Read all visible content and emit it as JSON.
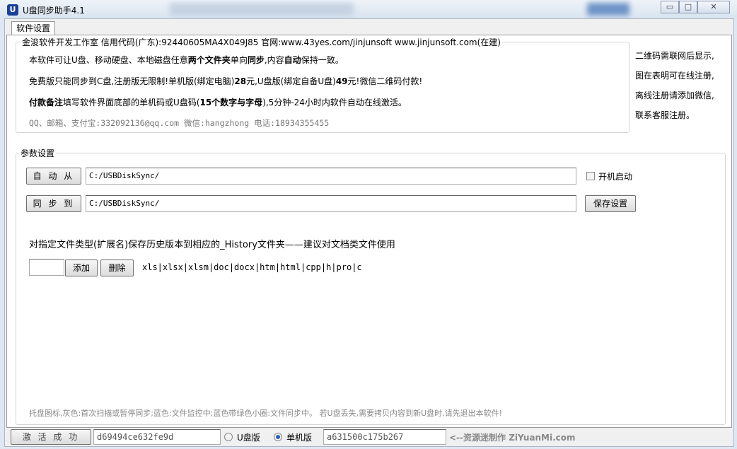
{
  "window": {
    "title": "U盘同步助手4.1",
    "icon_letter": "U",
    "minimize": "▭",
    "maximize": "□",
    "close": "✕"
  },
  "tabs": [
    {
      "label": "软件设置"
    }
  ],
  "info": {
    "legend": "金浚软件开发工作室 信用代码(广东):92440605MA4X049J85 官网:www.43yes.com/jinjunsoft  www.jinjunsoft.com(在建)",
    "lines": [
      [
        {
          "t": "本软件可让U盘、移动硬盘、本地磁盘任意",
          "b": false
        },
        {
          "t": "两个文件夹",
          "b": true
        },
        {
          "t": "单向",
          "b": false
        },
        {
          "t": "同步",
          "b": true
        },
        {
          "t": ",内容",
          "b": false
        },
        {
          "t": "自动",
          "b": true
        },
        {
          "t": "保持一致。",
          "b": false
        }
      ],
      [
        {
          "t": "免费版只能同步到C盘,注册版无限制!单机版(绑定电脑)",
          "b": false
        },
        {
          "t": "28",
          "b": true
        },
        {
          "t": "元,U盘版(绑定自备U盘)",
          "b": false
        },
        {
          "t": "49",
          "b": true
        },
        {
          "t": "元!微信二维码付款!",
          "b": false
        }
      ],
      [
        {
          "t": "付款备注",
          "b": true
        },
        {
          "t": "填写软件界面底部的单机码或U盘码(",
          "b": false
        },
        {
          "t": "15个数字与字母",
          "b": true
        },
        {
          "t": "),5分钟-24小时内软件自动在线激活。",
          "b": false
        }
      ]
    ],
    "contact": "QQ、邮箱、支付宝:332092136@qq.com    微信:hangzhong    电话:18934355455"
  },
  "side_note": [
    "二维码需联网后显示,",
    "图在表明可在线注册,",
    "离线注册请添加微信,",
    "联系客服注册。"
  ],
  "params": {
    "legend": "参数设置",
    "from_button": "自 动 从",
    "from_path": "C:/USBDiskSync/",
    "to_button": "同 步 到",
    "to_path": "C:/USBDiskSync/",
    "autostart_label": "开机启动",
    "autostart_checked": false,
    "save_button": "保存设置",
    "history_desc": "对指定文件类型(扩展名)保存历史版本到相应的_History文件夹——建议对文档类文件使用",
    "ext_input": "",
    "add_button": "添加",
    "delete_button": "删除",
    "extensions": "xls|xlsx|xlsm|doc|docx|htm|html|cpp|h|pro|c",
    "tray_hint": "托盘图标,灰色:首次扫描或暂停同步;蓝色:文件监控中;蓝色带绿色小圈:文件同步中。 若U盘丢失,需要拷贝内容到新U盘时,请先退出本软件!"
  },
  "footer": {
    "activate_button": "激 活 成 功",
    "machine_code": "d69494ce632fe9d",
    "radio_udisk": "U盘版",
    "radio_single": "单机版",
    "selected": "单机版",
    "udisk_code": "a631500c175b267",
    "credit": "<--资源迷制作 ZiYuanMi.com"
  }
}
